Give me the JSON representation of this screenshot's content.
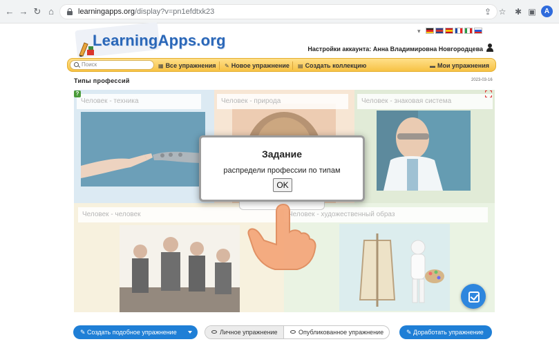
{
  "browser": {
    "url_host": "learningapps.org",
    "url_path": "/display?v=pn1efdtxk23",
    "profile_initial": "A"
  },
  "header": {
    "logo": "LearningApps.org",
    "lang_caret": "▾",
    "account_text": "Настройки аккаунта: Анна Владимировна Новгородцева"
  },
  "menubar": {
    "search_placeholder": "Поиск",
    "all_exercises": "Все упражнения",
    "new_exercise": "Новое упражнение",
    "create_collection": "Создать коллекцию",
    "my_exercises": "Мои упражнения"
  },
  "page": {
    "title": "Типы профессий",
    "date": "2023-03-16"
  },
  "categories": [
    {
      "label": "Человек - техника"
    },
    {
      "label": "Человек - природа"
    },
    {
      "label": "Человек - знаковая система"
    },
    {
      "label": "Человек - человек"
    },
    {
      "label": "Человек - художественный образ"
    }
  ],
  "modal": {
    "title": "Задание",
    "text": "распредели профессии по типам",
    "ok": "OK"
  },
  "footer": {
    "create_similar": "Создать подобное упражнение",
    "personal": "Личное упражнение",
    "published": "Опубликованное упражнение",
    "improve": "Доработать упражнение"
  },
  "colors": {
    "accent_blue": "#1f7fd6",
    "menubar_orange": "#f7c245",
    "logo_blue": "#2a67b8"
  }
}
